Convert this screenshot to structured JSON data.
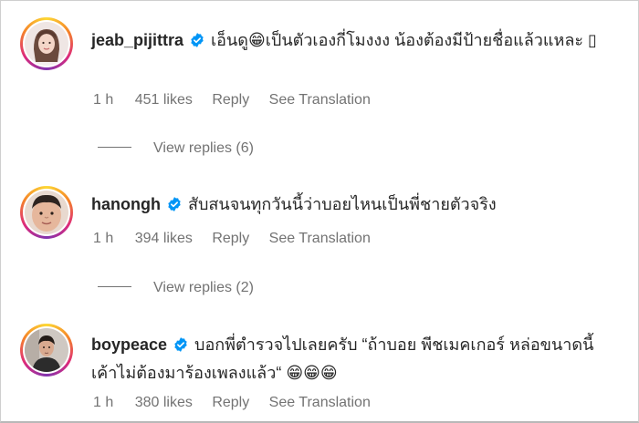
{
  "comments": [
    {
      "username": "jeab_pijittra",
      "verified": true,
      "text": "เอ็นดู😁เป็นตัวเองกี่โมงงง น้องต้องมีป้ายชื่อแล้วแหละ ▯",
      "time": "1 h",
      "likes": "451 likes",
      "reply_label": "Reply",
      "translate_label": "See Translation",
      "view_replies": "View replies (6)",
      "avatar_icon": "woman-portrait-avatar"
    },
    {
      "username": "hanongh",
      "verified": true,
      "text": "สับสนจนทุกวันนี้ว่าบอยไหนเป็นพี่ชายตัวจริง",
      "time": "1 h",
      "likes": "394 likes",
      "reply_label": "Reply",
      "translate_label": "See Translation",
      "view_replies": "View replies (2)",
      "avatar_icon": "man-face-avatar"
    },
    {
      "username": "boypeace",
      "verified": true,
      "text": "บอกพี่ตำรวจไปเลยครับ “ถ้าบอย พีชเมคเกอร์ หล่อขนาดนี้เค้าไม่ต้องมาร้องเพลงแล้ว“ 😁😁😁",
      "time": "1 h",
      "likes": "380 likes",
      "reply_label": "Reply",
      "translate_label": "See Translation",
      "avatar_icon": "man-portrait-avatar"
    }
  ],
  "colors": {
    "text": "#262626",
    "secondary": "#737373",
    "verified_blue": "#0095f6"
  }
}
